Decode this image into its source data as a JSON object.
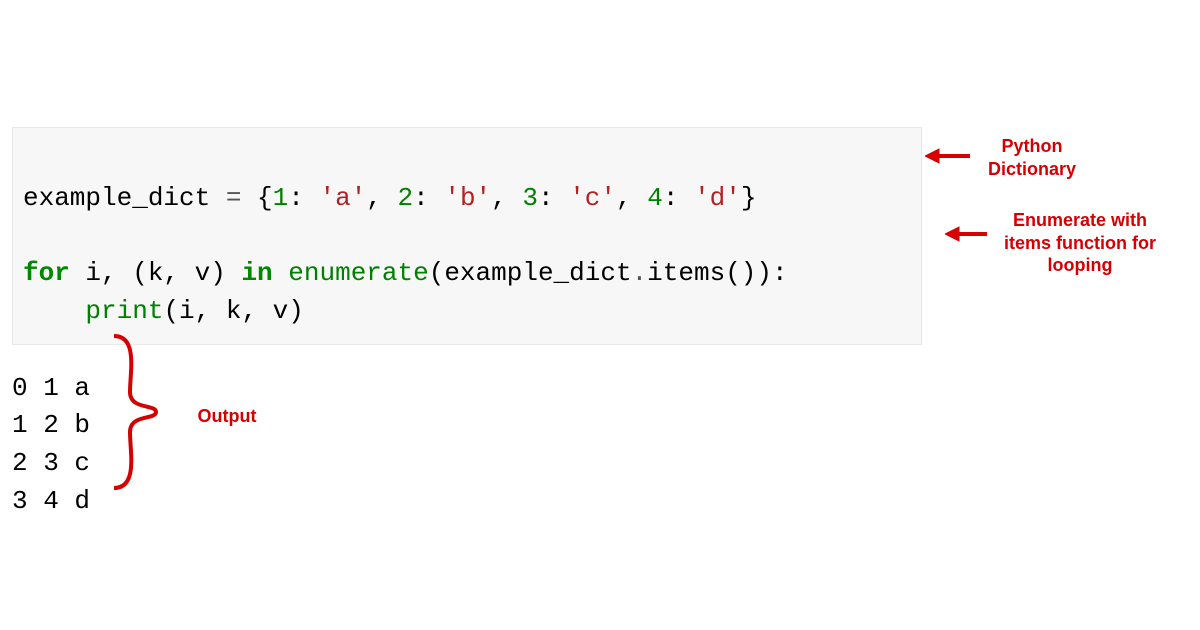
{
  "code": {
    "line1": {
      "var": "example_dict",
      "eq": " = ",
      "lbrace": "{",
      "k1": "1",
      "colon1": ": ",
      "v1": "'a'",
      "c1": ", ",
      "k2": "2",
      "colon2": ": ",
      "v2": "'b'",
      "c2": ", ",
      "k3": "3",
      "colon3": ": ",
      "v3": "'c'",
      "c3": ", ",
      "k4": "4",
      "colon4": ": ",
      "v4": "'d'",
      "rbrace": "}"
    },
    "blank": "",
    "line2": {
      "for": "for",
      "vars": " i, (k, v) ",
      "in": "in",
      "sp": " ",
      "enum": "enumerate",
      "lp": "(",
      "obj": "example_dict",
      "dot": ".",
      "items": "items",
      "rp": "())",
      "end": ":"
    },
    "line3": {
      "indent": "    ",
      "print": "print",
      "lp": "(",
      "args": "i, k, v",
      "rp": ")"
    }
  },
  "output": {
    "r0": "0 1 a",
    "r1": "1 2 b",
    "r2": "2 3 c",
    "r3": "3 4 d"
  },
  "annotations": {
    "dict": "Python\nDictionary",
    "enum": "Enumerate with\nitems function for\nlooping",
    "output": "Output"
  },
  "colors": {
    "accent": "#d60000"
  }
}
